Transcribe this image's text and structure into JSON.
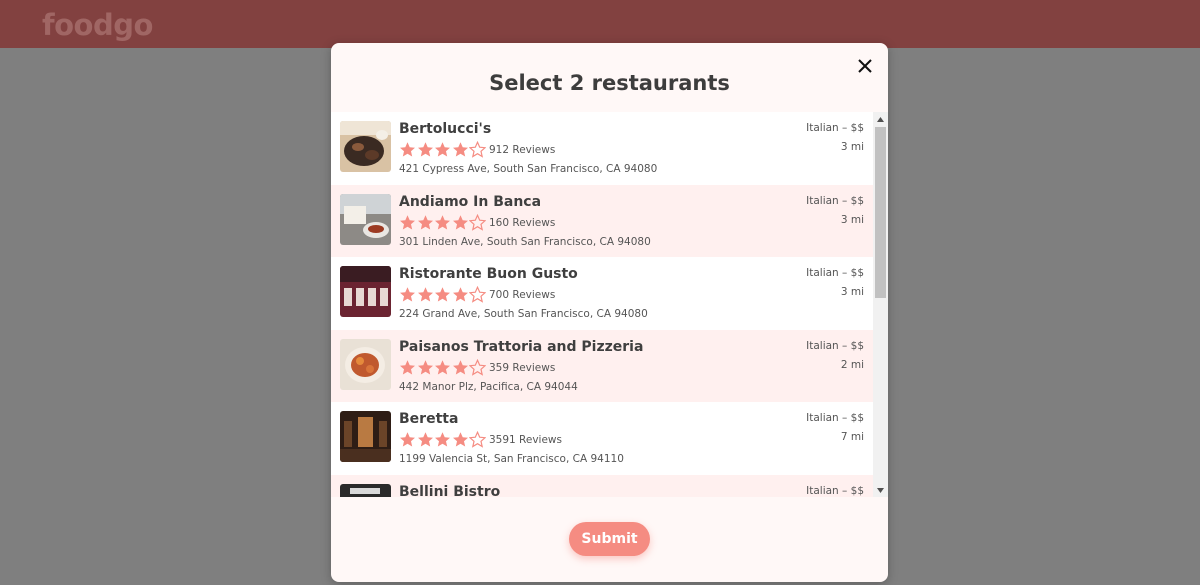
{
  "app": {
    "logo": "foodgo"
  },
  "modal": {
    "title": "Select 2 restaurants",
    "submit_label": "Submit"
  },
  "colors": {
    "brand": "#824140",
    "accent": "#f58c82",
    "star": "#f58c82",
    "alt_row": "#fff0ef"
  },
  "restaurants": [
    {
      "name": "Bertolucci's",
      "rating": 4,
      "max_rating": 5,
      "reviews": "912 Reviews",
      "address": "421 Cypress Ave, South San Francisco, CA 94080",
      "category": "Italian – $$",
      "distance": "3 mi"
    },
    {
      "name": "Andiamo In Banca",
      "rating": 4,
      "max_rating": 5,
      "reviews": "160 Reviews",
      "address": "301 Linden Ave, South San Francisco, CA 94080",
      "category": "Italian – $$",
      "distance": "3 mi"
    },
    {
      "name": "Ristorante Buon Gusto",
      "rating": 4,
      "max_rating": 5,
      "reviews": "700 Reviews",
      "address": "224 Grand Ave, South San Francisco, CA 94080",
      "category": "Italian – $$",
      "distance": "3 mi"
    },
    {
      "name": "Paisanos Trattoria and Pizzeria",
      "rating": 4,
      "max_rating": 5,
      "reviews": "359 Reviews",
      "address": "442 Manor Plz, Pacifica, CA 94044",
      "category": "Italian – $$",
      "distance": "2 mi"
    },
    {
      "name": "Beretta",
      "rating": 4,
      "max_rating": 5,
      "reviews": "3591 Reviews",
      "address": "1199 Valencia St, San Francisco, CA 94110",
      "category": "Italian – $$",
      "distance": "7 mi"
    },
    {
      "name": "Bellini Bistro",
      "category": "Italian – $$"
    }
  ]
}
